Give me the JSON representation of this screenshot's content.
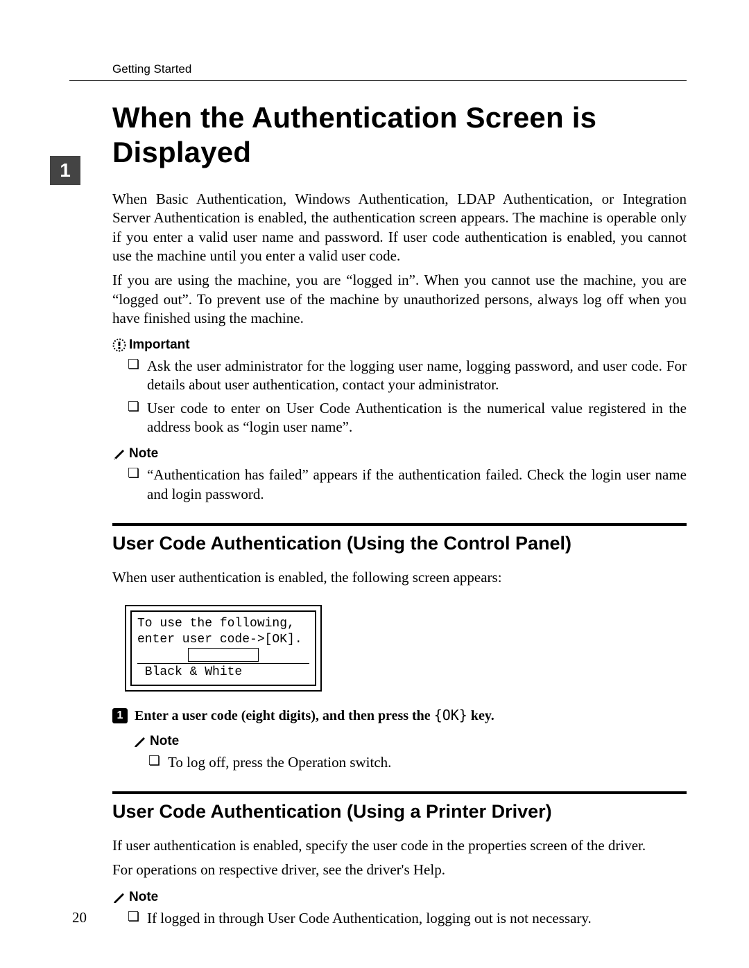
{
  "header": {
    "section": "Getting Started"
  },
  "tab": {
    "number": "1"
  },
  "title": "When the Authentication Screen is Displayed",
  "paragraphs": {
    "intro1": "When Basic Authentication, Windows Authentication, LDAP Authentication, or Integration Server Authentication is enabled, the authentication screen appears. The machine is operable only if you enter a valid user name and password. If user code authentication is enabled, you cannot use the machine until you enter a valid user code.",
    "intro2": "If you are using the machine, you are “logged in”. When you cannot use the machine, you are “logged out”. To prevent use of the machine by unauthorized persons, always log off when you have finished using the machine."
  },
  "important": {
    "label": "Important",
    "items": [
      "Ask the user administrator for the logging user name, logging password, and user code. For details about user authentication, contact your administrator.",
      "User code to enter on User Code Authentication is the numerical value registered in the address book as “login user name”."
    ]
  },
  "note1": {
    "label": "Note",
    "items": [
      "“Authentication has failed” appears if the authentication failed. Check the login user name and login password."
    ]
  },
  "sectionA": {
    "heading": "User Code Authentication (Using the Control Panel)",
    "lead": "When user authentication is enabled, the following screen appears:",
    "screen": {
      "line1": "To use the following,",
      "line2": "enter user code->[OK].",
      "line3": " Black & White"
    },
    "step1": {
      "num": "1",
      "pre": "Enter a user code (eight digits), and then press the ",
      "ok": "{OK}",
      "post": " key."
    },
    "note": {
      "label": "Note",
      "items": [
        "To log off, press the Operation switch."
      ]
    }
  },
  "sectionB": {
    "heading": "User Code Authentication (Using a Printer Driver)",
    "p1": "If user authentication is enabled, specify the user code in the properties screen of the driver.",
    "p2": "For operations on respective driver, see the driver's Help.",
    "note": {
      "label": "Note",
      "items": [
        "If logged in through User Code Authentication, logging out is not necessary."
      ]
    }
  },
  "pageNumber": "20",
  "bullet": "❏"
}
